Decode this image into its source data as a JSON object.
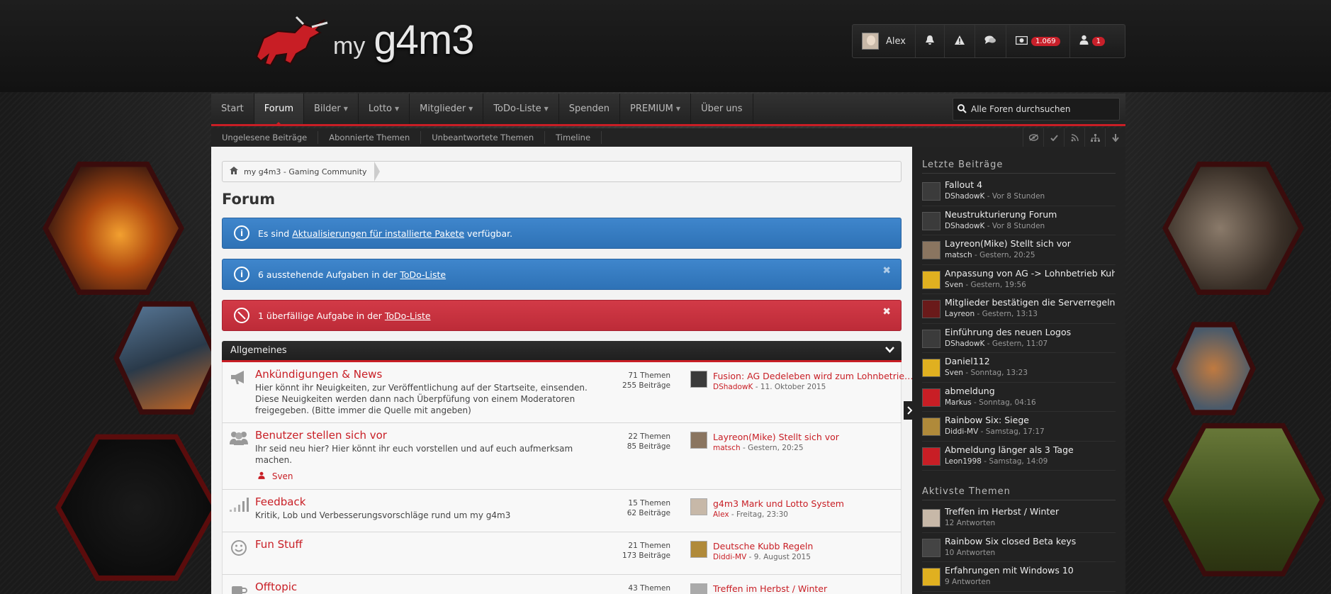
{
  "header": {
    "logo_my": "my",
    "logo_main": "g4m3"
  },
  "userbar": {
    "username": "Alex",
    "credits_badge": "1.069",
    "friend_badge": "1",
    "icons": [
      "bell-icon",
      "warning-icon",
      "chat-icon",
      "money-icon",
      "user-icon"
    ]
  },
  "mainnav": {
    "items": [
      {
        "label": "Start",
        "dropdown": false
      },
      {
        "label": "Forum",
        "dropdown": false
      },
      {
        "label": "Bilder",
        "dropdown": true
      },
      {
        "label": "Lotto",
        "dropdown": true
      },
      {
        "label": "Mitglieder",
        "dropdown": true
      },
      {
        "label": "ToDo-Liste",
        "dropdown": true
      },
      {
        "label": "Spenden",
        "dropdown": false
      },
      {
        "label": "PREMIUM",
        "dropdown": true
      },
      {
        "label": "Über uns",
        "dropdown": false
      }
    ],
    "search_placeholder": "Alle Foren durchsuchen"
  },
  "subnav": {
    "items": [
      "Ungelesene Beiträge",
      "Abonnierte Themen",
      "Unbeantwortete Themen",
      "Timeline"
    ]
  },
  "breadcrumb": {
    "home": "my g4m3 - Gaming Community"
  },
  "page_title": "Forum",
  "notices": [
    {
      "type": "info",
      "pre": "Es sind ",
      "link": "Aktualisierungen für installierte Pakete",
      "post": " verfügbar.",
      "closable": false
    },
    {
      "type": "info",
      "pre": "6 ausstehende Aufgaben in der ",
      "link": "ToDo-Liste",
      "post": "",
      "closable": true
    },
    {
      "type": "error",
      "pre": "1 überfällige Aufgabe in der ",
      "link": "ToDo-Liste",
      "post": "",
      "closable": true
    }
  ],
  "category": {
    "title": "Allgemeines"
  },
  "boards": [
    {
      "icon": "megaphone-icon",
      "title": "Ankündigungen & News",
      "desc": "Hier könnt ihr Neuigkeiten, zur Veröffentlichung auf der Startseite, einsenden. Diese Neuigkeiten werden dann nach Überpfüfung von einem Moderatoren freigegeben. (Bitte immer die Quelle mit angeben)",
      "mod": "",
      "topics": "71 Themen",
      "posts": "255 Beiträge",
      "last_title": "Fusion: AG Dedeleben wird zum Lohnbetrieb Ku...",
      "last_user": "DShadowK",
      "last_time": " - 11. Oktober 2015",
      "av_color": "#3b3b3b"
    },
    {
      "icon": "users-icon",
      "title": "Benutzer stellen sich vor",
      "desc": "Ihr seid neu hier? Hier könnt ihr euch vorstellen und auf euch aufmerksam machen.",
      "mod": "Sven",
      "topics": "22 Themen",
      "posts": "85 Beiträge",
      "last_title": "Layreon(Mike) Stellt sich vor",
      "last_user": "matsch",
      "last_time": " - Gestern, 20:25",
      "av_color": "#8a7560"
    },
    {
      "icon": "signal-icon",
      "title": "Feedback",
      "desc": "Kritik, Lob und Verbesserungsvorschläge rund um my g4m3",
      "mod": "",
      "topics": "15 Themen",
      "posts": "62 Beiträge",
      "last_title": "g4m3 Mark und Lotto System",
      "last_user": "Alex",
      "last_time": " - Freitag, 23:30",
      "av_color": "#c7b8a8"
    },
    {
      "icon": "smile-icon",
      "title": "Fun Stuff",
      "desc": "",
      "mod": "",
      "topics": "21 Themen",
      "posts": "173 Beiträge",
      "last_title": "Deutsche Kubb Regeln",
      "last_user": "Diddi-MV",
      "last_time": " - 9. August 2015",
      "av_color": "#b08a3a"
    },
    {
      "icon": "coffee-icon",
      "title": "Offtopic",
      "desc": "",
      "mod": "",
      "topics": "43 Themen",
      "posts": "",
      "last_title": "Treffen im Herbst / Winter",
      "last_user": "",
      "last_time": "",
      "av_color": "#aaa"
    }
  ],
  "sidebar": {
    "latest_head": "Letzte Beiträge",
    "latest": [
      {
        "title": "Fallout 4",
        "user": "DShadowK",
        "time": " - Vor 8 Stunden",
        "av": "#3b3b3b"
      },
      {
        "title": "Neustrukturierung Forum",
        "user": "DShadowK",
        "time": " - Vor 8 Stunden",
        "av": "#3b3b3b"
      },
      {
        "title": "Layreon(Mike) Stellt sich vor",
        "user": "matsch",
        "time": " - Gestern, 20:25",
        "av": "#8a7560"
      },
      {
        "title": "Anpassung von AG -> Lohnbetrieb Kuhn",
        "user": "Sven",
        "time": " - Gestern, 19:56",
        "av": "#e0b020"
      },
      {
        "title": "Mitglieder bestätigen die Serverregeln!",
        "user": "Layreon",
        "time": " - Gestern, 13:13",
        "av": "#6a1a1a"
      },
      {
        "title": "Einführung des neuen Logos",
        "user": "DShadowK",
        "time": " - Gestern, 11:07",
        "av": "#3b3b3b"
      },
      {
        "title": "Daniel112",
        "user": "Sven",
        "time": " - Sonntag, 13:23",
        "av": "#e0b020"
      },
      {
        "title": "abmeldung",
        "user": "Markus",
        "time": " - Sonntag, 04:16",
        "av": "#c81e25"
      },
      {
        "title": "Rainbow Six: Siege",
        "user": "Diddi-MV",
        "time": " - Samstag, 17:17",
        "av": "#b08a3a"
      },
      {
        "title": "Abmeldung länger als 3 Tage",
        "user": "Leon1998",
        "time": " - Samstag, 14:09",
        "av": "#c81e25"
      }
    ],
    "active_head": "Aktivste Themen",
    "active": [
      {
        "title": "Treffen im Herbst / Winter",
        "meta": "12 Antworten",
        "av": "#c7b8a8"
      },
      {
        "title": "Rainbow Six closed Beta keys",
        "meta": "10 Antworten",
        "av": "#444"
      },
      {
        "title": "Erfahrungen mit Windows 10",
        "meta": "9 Antworten",
        "av": "#e0b020"
      }
    ]
  }
}
